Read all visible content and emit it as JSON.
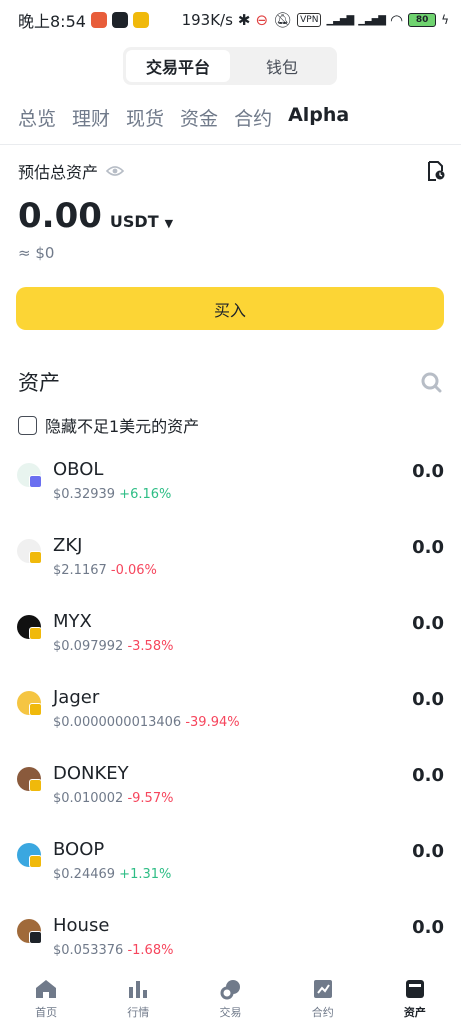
{
  "status_bar": {
    "time": "晚上8:54",
    "net_speed": "193K/s",
    "vpn": "VPN",
    "signal1": "HD",
    "signal2": "HD",
    "battery": "80"
  },
  "switch": {
    "options": [
      "交易平台",
      "钱包"
    ],
    "active": "交易平台"
  },
  "tabs": [
    "总览",
    "理财",
    "现货",
    "资金",
    "合约",
    "Alpha"
  ],
  "active_tab": "Alpha",
  "estimated": {
    "label": "预估总资产",
    "amount": "0.00",
    "unit": "USDT",
    "approx": "≈ $0"
  },
  "buy_button": "买入",
  "assets": {
    "title": "资产",
    "hide_small_label": "隐藏不足1美元的资产",
    "items": [
      {
        "name": "OBOL",
        "price": "$0.32939",
        "change": "+6.16%",
        "direction": "up",
        "amount": "0.0",
        "icon_color": "#e8f4ef",
        "sub_color": "#6a6ff0"
      },
      {
        "name": "ZKJ",
        "price": "$2.1167",
        "change": "-0.06%",
        "direction": "down",
        "amount": "0.0",
        "icon_color": "#f0f0f0",
        "sub_color": "#f0b90b"
      },
      {
        "name": "MYX",
        "price": "$0.097992",
        "change": "-3.58%",
        "direction": "down",
        "amount": "0.0",
        "icon_color": "#111111",
        "sub_color": "#f0b90b"
      },
      {
        "name": "Jager",
        "price": "$0.0000000013406",
        "change": "-39.94%",
        "direction": "down",
        "amount": "0.0",
        "icon_color": "#f5c542",
        "sub_color": "#f0b90b"
      },
      {
        "name": "DONKEY",
        "price": "$0.010002",
        "change": "-9.57%",
        "direction": "down",
        "amount": "0.0",
        "icon_color": "#8a5a3c",
        "sub_color": "#f0b90b"
      },
      {
        "name": "BOOP",
        "price": "$0.24469",
        "change": "+1.31%",
        "direction": "up",
        "amount": "0.0",
        "icon_color": "#3aa7e0",
        "sub_color": "#f0b90b"
      },
      {
        "name": "House",
        "price": "$0.053376",
        "change": "-1.68%",
        "direction": "down",
        "amount": "0.0",
        "icon_color": "#a06a3a",
        "sub_color": "#1e2329"
      }
    ]
  },
  "bottom_nav": [
    {
      "label": "首页",
      "icon": "home-icon"
    },
    {
      "label": "行情",
      "icon": "market-chart-icon"
    },
    {
      "label": "交易",
      "icon": "trade-icon"
    },
    {
      "label": "合约",
      "icon": "futures-icon"
    },
    {
      "label": "资产",
      "icon": "wallet-icon"
    }
  ],
  "active_nav": "资产"
}
